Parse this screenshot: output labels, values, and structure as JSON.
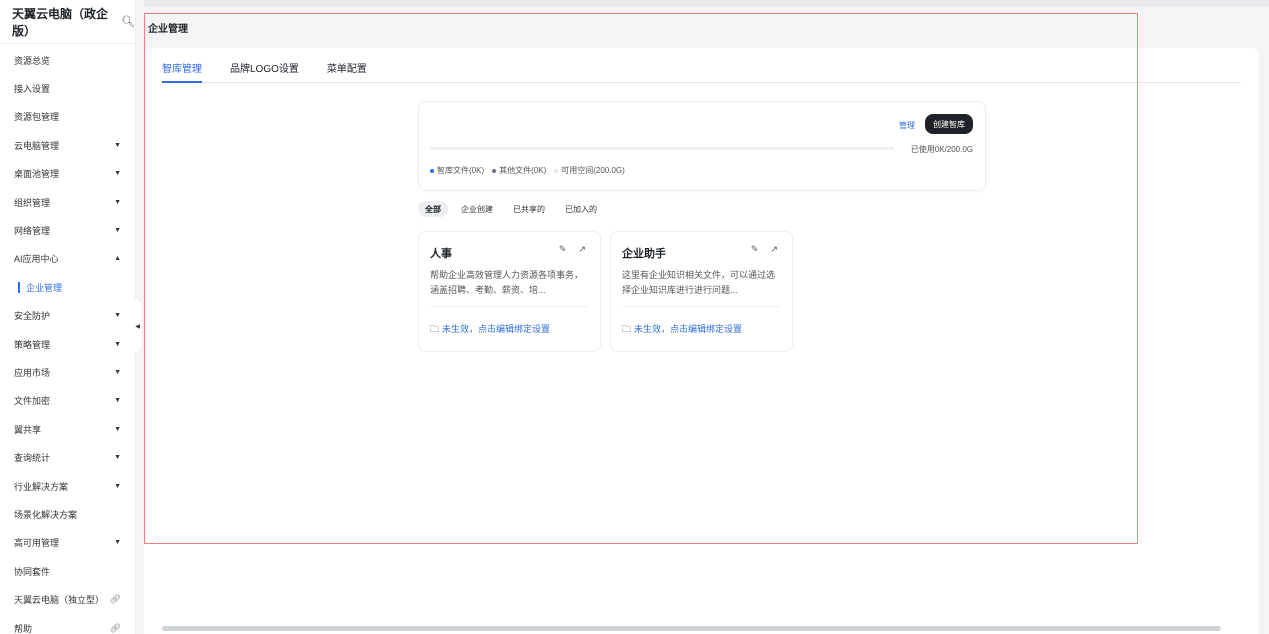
{
  "sidebar": {
    "brand": "天翼云电脑（政企版）",
    "items": [
      {
        "label": "资源总览",
        "caret": ""
      },
      {
        "label": "接入设置",
        "caret": ""
      },
      {
        "label": "资源包管理",
        "caret": ""
      },
      {
        "label": "云电脑管理",
        "caret": "▼"
      },
      {
        "label": "桌面池管理",
        "caret": "▼"
      },
      {
        "label": "组织管理",
        "caret": "▼"
      },
      {
        "label": "网络管理",
        "caret": "▼"
      },
      {
        "label": "AI应用中心",
        "caret": "▲"
      },
      {
        "label": "企业管理",
        "caret": ""
      },
      {
        "label": "安全防护",
        "caret": "▼"
      },
      {
        "label": "策略管理",
        "caret": "▼"
      },
      {
        "label": "应用市场",
        "caret": "▼"
      },
      {
        "label": "文件加密",
        "caret": "▼"
      },
      {
        "label": "翼共享",
        "caret": "▼"
      },
      {
        "label": "查询统计",
        "caret": "▼"
      },
      {
        "label": "行业解决方案",
        "caret": "▼"
      },
      {
        "label": "场景化解决方案",
        "caret": ""
      },
      {
        "label": "高可用管理",
        "caret": "▼"
      },
      {
        "label": "协同套件",
        "caret": ""
      },
      {
        "label": "天翼云电脑（独立型）",
        "caret": ""
      },
      {
        "label": "帮助",
        "caret": ""
      }
    ]
  },
  "page": {
    "title": "企业管理",
    "tabs": [
      "智库管理",
      "品牌LOGO设置",
      "菜单配置"
    ]
  },
  "storage": {
    "manage": "管理",
    "create": "创建智库",
    "used": "已使用0K/200.0G",
    "usage_fraction": 0,
    "legend": [
      {
        "label": "智库文件(0K)",
        "color": "#2f6ee0"
      },
      {
        "label": "其他文件(0K)",
        "color": "#6b7280"
      },
      {
        "label": "可用空间(200.0G)",
        "color": "#e5e7eb"
      }
    ]
  },
  "filters": [
    "全部",
    "企业创建",
    "已共享的",
    "已加入的"
  ],
  "cards": [
    {
      "title": "人事",
      "desc": "帮助企业高效管理人力资源各项事务，涵盖招聘、考勤、薪资、培...",
      "status": "未生效，点击编辑绑定设置"
    },
    {
      "title": "企业助手",
      "desc": "这里有企业知识相关文件，可以通过选择企业知识库进行进行问题...",
      "status": "未生效，点击编辑绑定设置"
    }
  ]
}
